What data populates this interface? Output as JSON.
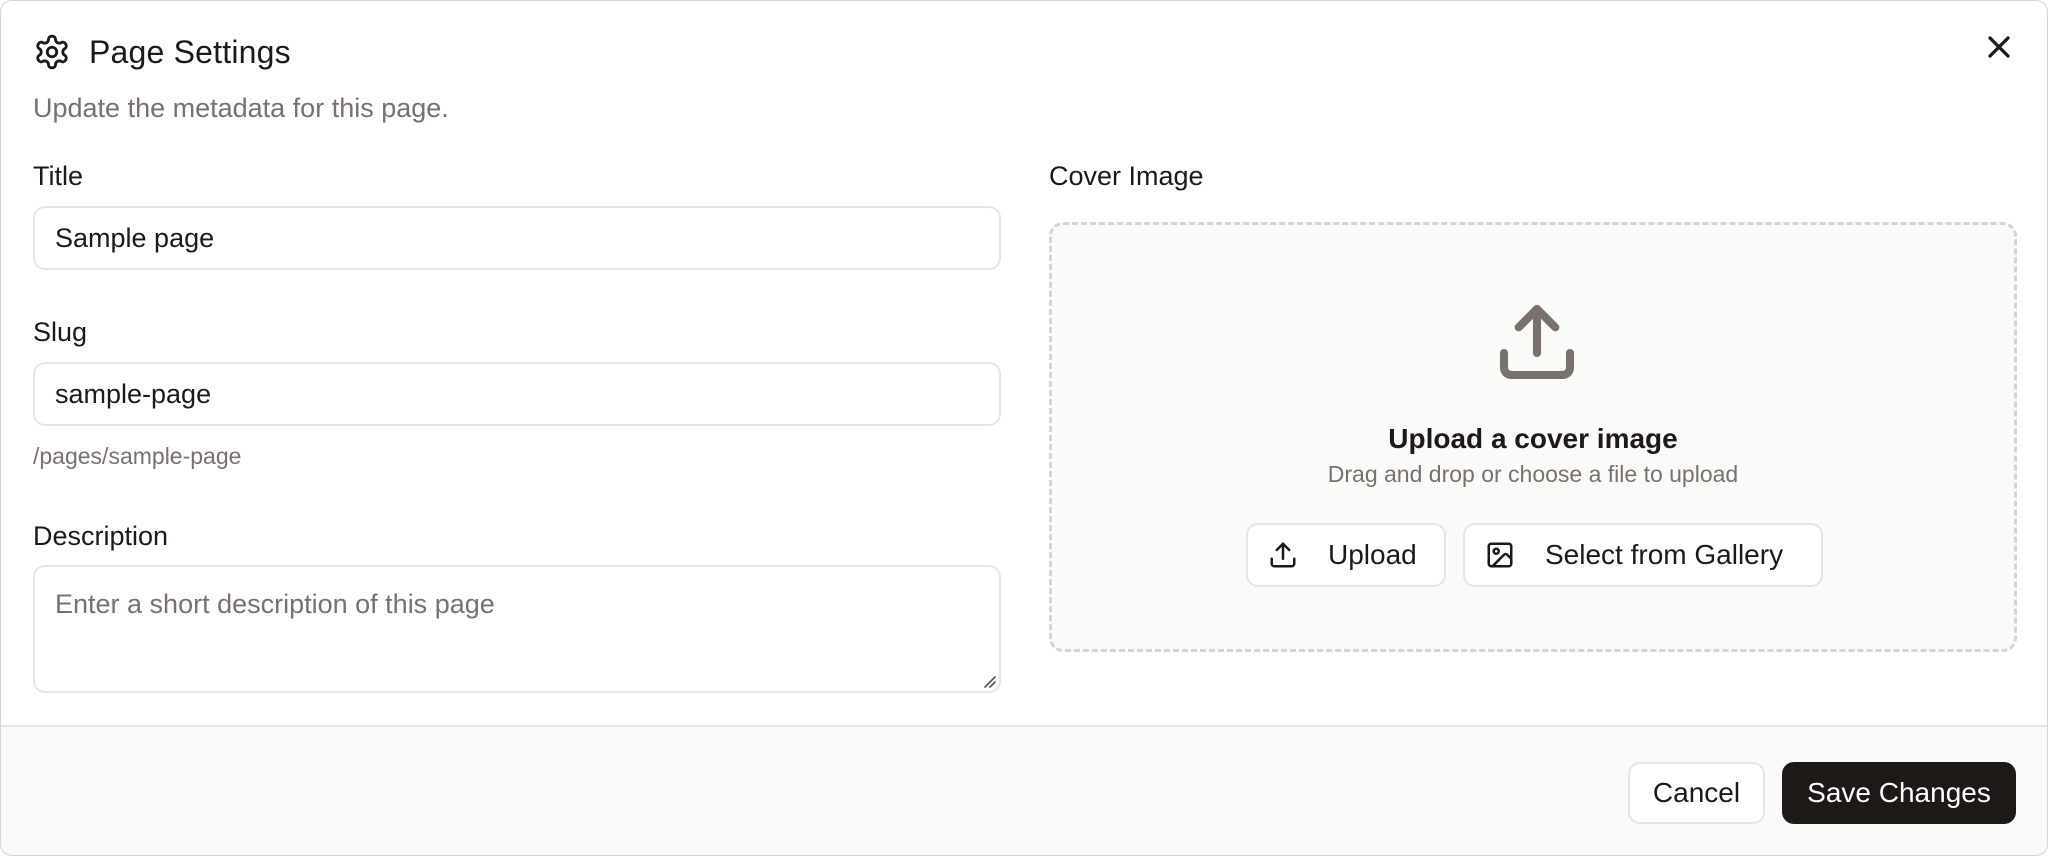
{
  "dialog": {
    "title": "Page Settings",
    "subtitle": "Update the metadata for this page.",
    "icons": {
      "header": "gear-icon",
      "close": "close-icon"
    }
  },
  "form": {
    "title_label": "Title",
    "title_value": "Sample page",
    "slug_label": "Slug",
    "slug_value": "sample-page",
    "slug_hint": "/pages/sample-page",
    "description_label": "Description",
    "description_placeholder": "Enter a short description of this page",
    "description_value": ""
  },
  "cover": {
    "label": "Cover Image",
    "upload_title": "Upload a cover image",
    "upload_subtitle": "Drag and drop or choose a file to upload",
    "upload_button": "Upload",
    "gallery_button": "Select from Gallery",
    "icons": {
      "dropzone": "upload-icon",
      "upload_button": "upload-icon",
      "gallery_button": "image-icon"
    }
  },
  "footer": {
    "cancel_label": "Cancel",
    "save_label": "Save Changes"
  },
  "colors": {
    "primary": "#1c1917",
    "muted_text": "#78716c",
    "border": "#e7e5e4",
    "dropzone_bg": "#fafaf9"
  }
}
